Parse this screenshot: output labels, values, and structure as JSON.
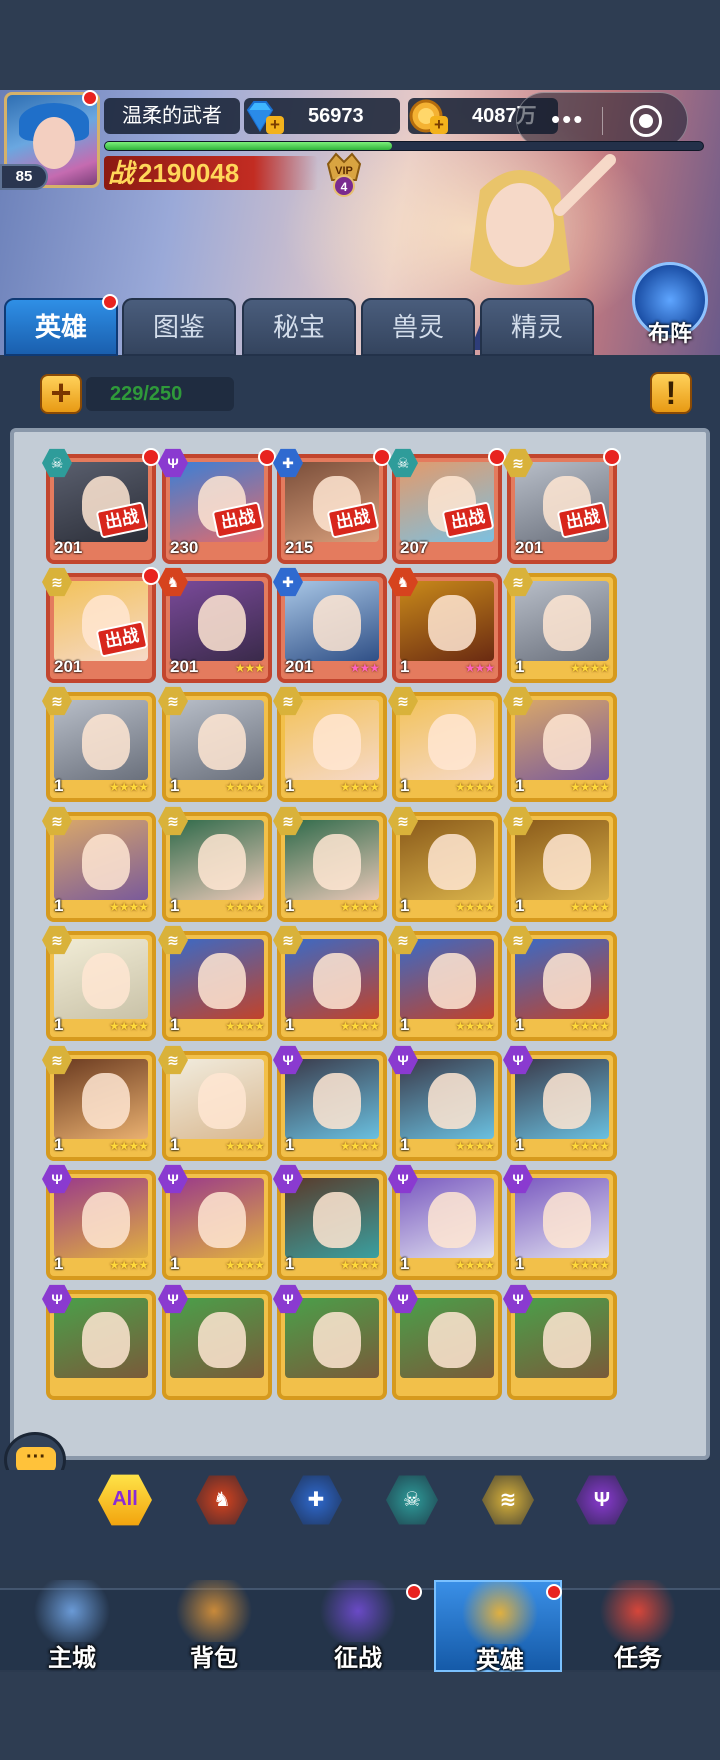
{
  "player": {
    "name": "温柔的武者",
    "level": "85",
    "gems": "56973",
    "gold": "4087万",
    "power_label": "战",
    "power": "2190048",
    "vip": "VIP",
    "vip_level": "4",
    "exp_progress": 0.48
  },
  "capsule": {
    "more": "•••"
  },
  "formation_label": "布阵",
  "tabs": [
    "英雄",
    "图鉴",
    "秘宝",
    "兽灵",
    "精灵"
  ],
  "hero_count": "229/250",
  "warn_label": "!",
  "deploy_stamp": "出战",
  "chat_icon": "···",
  "filter_all_label": "All",
  "colors": {
    "faction_dark": "#2e9c9a",
    "faction_light": "#d9b23a",
    "faction_fire": "#d6431e",
    "faction_water": "#2f6ad0",
    "faction_void": "#8a3ad0"
  },
  "heroes": [
    {
      "level": "201",
      "faction": "dark",
      "frame": "red",
      "stars": "",
      "deployed": true,
      "dot": true,
      "art": "dark-mask-hero"
    },
    {
      "level": "230",
      "faction": "void",
      "frame": "red",
      "stars": "",
      "deployed": true,
      "dot": true,
      "art": "blue-hair-hero"
    },
    {
      "level": "215",
      "faction": "water",
      "frame": "red",
      "stars": "",
      "deployed": true,
      "dot": true,
      "art": "swordsman-hero"
    },
    {
      "level": "207",
      "faction": "dark",
      "frame": "red",
      "stars": "",
      "deployed": true,
      "dot": true,
      "art": "elf-hero"
    },
    {
      "level": "201",
      "faction": "light",
      "frame": "red",
      "stars": "",
      "deployed": true,
      "dot": true,
      "art": "armor-knight"
    },
    {
      "level": "201",
      "faction": "light",
      "frame": "red",
      "stars": "",
      "deployed": true,
      "dot": true,
      "art": "blonde-girl"
    },
    {
      "level": "201",
      "faction": "fire",
      "frame": "red",
      "stars": "★★★",
      "deployed": false,
      "dot": false,
      "art": "purple-giant"
    },
    {
      "level": "201",
      "faction": "water",
      "frame": "red",
      "stars": "★★★",
      "deployed": false,
      "dot": false,
      "art": "silver-hair-hero",
      "pink": true
    },
    {
      "level": "1",
      "faction": "fire",
      "frame": "red",
      "stars": "★★★",
      "deployed": false,
      "dot": false,
      "art": "gold-helmet",
      "pink": true
    },
    {
      "level": "1",
      "faction": "light",
      "frame": "gold",
      "stars": "★★★★",
      "deployed": false,
      "dot": false,
      "art": "armor-knight"
    },
    {
      "level": "1",
      "faction": "light",
      "frame": "gold",
      "stars": "★★★★",
      "deployed": false,
      "dot": false,
      "art": "armor-knight"
    },
    {
      "level": "1",
      "faction": "light",
      "frame": "gold",
      "stars": "★★★★",
      "deployed": false,
      "dot": false,
      "art": "armor-knight"
    },
    {
      "level": "1",
      "faction": "light",
      "frame": "gold",
      "stars": "★★★★",
      "deployed": false,
      "dot": false,
      "art": "blonde-girl"
    },
    {
      "level": "1",
      "faction": "light",
      "frame": "gold",
      "stars": "★★★★",
      "deployed": false,
      "dot": false,
      "art": "blonde-girl"
    },
    {
      "level": "1",
      "faction": "light",
      "frame": "gold",
      "stars": "★★★★",
      "deployed": false,
      "dot": false,
      "art": "elf-lord"
    },
    {
      "level": "1",
      "faction": "light",
      "frame": "gold",
      "stars": "★★★★",
      "deployed": false,
      "dot": false,
      "art": "elf-lord"
    },
    {
      "level": "1",
      "faction": "light",
      "frame": "gold",
      "stars": "★★★★",
      "deployed": false,
      "dot": false,
      "art": "green-hair-girl"
    },
    {
      "level": "1",
      "faction": "light",
      "frame": "gold",
      "stars": "★★★★",
      "deployed": false,
      "dot": false,
      "art": "green-hair-girl"
    },
    {
      "level": "1",
      "faction": "light",
      "frame": "gold",
      "stars": "★★★★",
      "deployed": false,
      "dot": false,
      "art": "gold-hood"
    },
    {
      "level": "1",
      "faction": "light",
      "frame": "gold",
      "stars": "★★★★",
      "deployed": false,
      "dot": false,
      "art": "gold-hood"
    },
    {
      "level": "1",
      "faction": "light",
      "frame": "gold",
      "stars": "★★★★",
      "deployed": false,
      "dot": false,
      "art": "white-angel"
    },
    {
      "level": "1",
      "faction": "light",
      "frame": "gold",
      "stars": "★★★★",
      "deployed": false,
      "dot": false,
      "art": "blue-troll"
    },
    {
      "level": "1",
      "faction": "light",
      "frame": "gold",
      "stars": "★★★★",
      "deployed": false,
      "dot": false,
      "art": "blue-troll"
    },
    {
      "level": "1",
      "faction": "light",
      "frame": "gold",
      "stars": "★★★★",
      "deployed": false,
      "dot": false,
      "art": "blue-troll"
    },
    {
      "level": "1",
      "faction": "light",
      "frame": "gold",
      "stars": "★★★★",
      "deployed": false,
      "dot": false,
      "art": "blue-troll"
    },
    {
      "level": "1",
      "faction": "light",
      "frame": "gold",
      "stars": "★★★★",
      "deployed": false,
      "dot": false,
      "art": "hooded-rogue"
    },
    {
      "level": "1",
      "faction": "light",
      "frame": "gold",
      "stars": "★★★★",
      "deployed": false,
      "dot": false,
      "art": "white-hood-priestess"
    },
    {
      "level": "1",
      "faction": "void",
      "frame": "gold",
      "stars": "★★★★",
      "deployed": false,
      "dot": false,
      "art": "dark-knight"
    },
    {
      "level": "1",
      "faction": "void",
      "frame": "gold",
      "stars": "★★★★",
      "deployed": false,
      "dot": false,
      "art": "dark-knight"
    },
    {
      "level": "1",
      "faction": "void",
      "frame": "gold",
      "stars": "★★★★",
      "deployed": false,
      "dot": false,
      "art": "dark-knight"
    },
    {
      "level": "1",
      "faction": "void",
      "frame": "gold",
      "stars": "★★★★",
      "deployed": false,
      "dot": false,
      "art": "purple-mask"
    },
    {
      "level": "1",
      "faction": "void",
      "frame": "gold",
      "stars": "★★★★",
      "deployed": false,
      "dot": false,
      "art": "purple-mask"
    },
    {
      "level": "1",
      "faction": "void",
      "frame": "gold",
      "stars": "★★★★",
      "deployed": false,
      "dot": false,
      "art": "horned-warrior"
    },
    {
      "level": "1",
      "faction": "void",
      "frame": "gold",
      "stars": "★★★★",
      "deployed": false,
      "dot": false,
      "art": "void-elf"
    },
    {
      "level": "1",
      "faction": "void",
      "frame": "gold",
      "stars": "★★★★",
      "deployed": false,
      "dot": false,
      "art": "void-elf"
    },
    {
      "level": "",
      "faction": "void",
      "frame": "gold",
      "stars": "",
      "deployed": false,
      "dot": false,
      "art": "green-dragon"
    },
    {
      "level": "",
      "faction": "void",
      "frame": "gold",
      "stars": "",
      "deployed": false,
      "dot": false,
      "art": "green-dragon"
    },
    {
      "level": "",
      "faction": "void",
      "frame": "gold",
      "stars": "",
      "deployed": false,
      "dot": false,
      "art": "green-dragon"
    },
    {
      "level": "",
      "faction": "void",
      "frame": "gold",
      "stars": "",
      "deployed": false,
      "dot": false,
      "art": "green-dragon"
    },
    {
      "level": "",
      "faction": "void",
      "frame": "gold",
      "stars": "",
      "deployed": false,
      "dot": false,
      "art": "green-dragon"
    }
  ],
  "filters": [
    {
      "key": "fire",
      "icon": "flame-helmet-icon",
      "glyph": "♞"
    },
    {
      "key": "water",
      "icon": "cross-shield-icon",
      "glyph": "✚"
    },
    {
      "key": "dark",
      "icon": "skull-icon",
      "glyph": "☠"
    },
    {
      "key": "light",
      "icon": "wing-icon",
      "glyph": "≋"
    },
    {
      "key": "void",
      "icon": "trident-icon",
      "glyph": "Ψ"
    }
  ],
  "nav": [
    {
      "label": "主城",
      "icon": "castle-icon",
      "active": false,
      "dot": false
    },
    {
      "label": "背包",
      "icon": "treasure-chest-icon",
      "active": false,
      "dot": false
    },
    {
      "label": "征战",
      "icon": "dragon-portal-icon",
      "active": false,
      "dot": true
    },
    {
      "label": "英雄",
      "icon": "hero-helmet-icon",
      "active": true,
      "dot": true
    },
    {
      "label": "任务",
      "icon": "scroll-icon",
      "active": false,
      "dot": false
    }
  ]
}
